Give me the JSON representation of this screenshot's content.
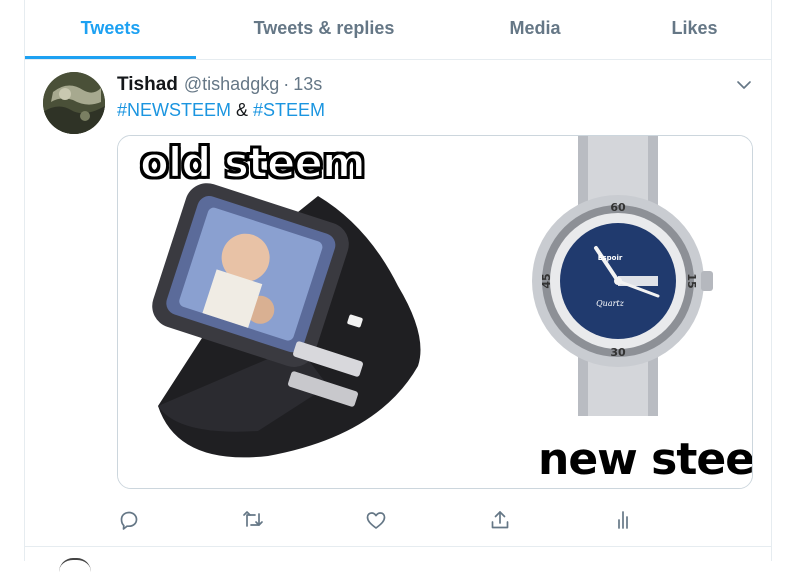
{
  "tabs": [
    {
      "label": "Tweets",
      "active": true
    },
    {
      "label": "Tweets & replies",
      "active": false
    },
    {
      "label": "Media",
      "active": false
    },
    {
      "label": "Likes",
      "active": false
    }
  ],
  "tweet": {
    "author_name": "Tishad",
    "author_handle": "@tishadgkg",
    "separator": "·",
    "timestamp": "13s",
    "hashtag_1": "#NEWSTEEM",
    "joiner": " & ",
    "hashtag_2": "#STEEM",
    "media": {
      "left_caption": "old steem",
      "right_caption": "new steem",
      "watch_brand": "Espoir",
      "watch_script": "Quartz",
      "dial_numbers": [
        "60",
        "15",
        "30",
        "45"
      ]
    },
    "actions": [
      "reply-icon",
      "retweet-icon",
      "like-icon",
      "share-icon",
      "analytics-icon"
    ]
  },
  "colors": {
    "accent": "#1da1f2",
    "link": "#1b95e0",
    "muted": "#657786",
    "border": "#e6ecf0"
  }
}
